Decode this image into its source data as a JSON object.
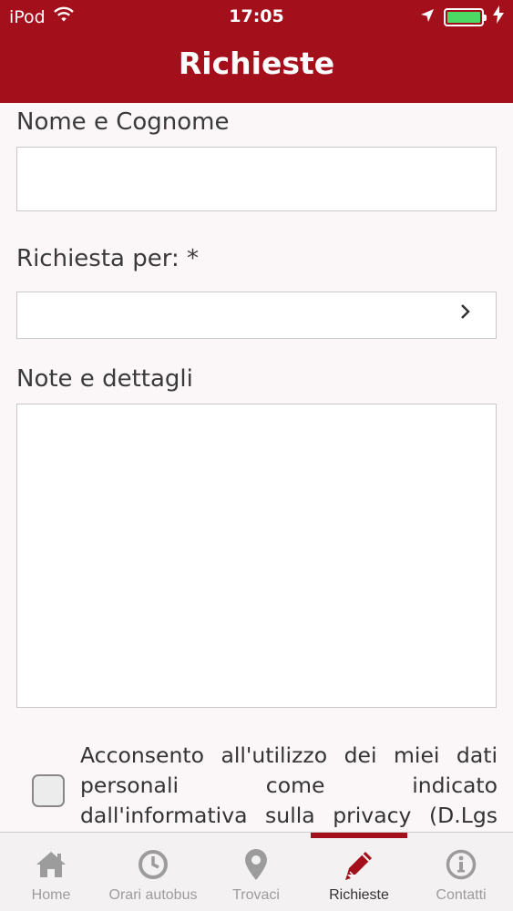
{
  "status": {
    "carrier": "iPod",
    "time": "17:05"
  },
  "header": {
    "title": "Richieste"
  },
  "form": {
    "name_label": "Nome e Cognome",
    "name_value": "",
    "request_label": "Richiesta per: *",
    "request_value": "",
    "notes_label": "Note e dettagli",
    "notes_value": "",
    "consent_text": "Acconsento all'utilizzo dei miei dati personali come indicato dall'informativa sulla privacy (D.Lgs",
    "consent_checked": false
  },
  "tabbar": {
    "active": "Richieste",
    "tabs": [
      {
        "label": "Home",
        "icon": "home-icon"
      },
      {
        "label": "Orari autobus",
        "icon": "clock-icon"
      },
      {
        "label": "Trovaci",
        "icon": "map-pin-icon"
      },
      {
        "label": "Richieste",
        "icon": "pencil-icon"
      },
      {
        "label": "Contatti",
        "icon": "info-icon"
      }
    ]
  },
  "colors": {
    "brand": "#a30f1a",
    "battery": "#4cd964"
  }
}
